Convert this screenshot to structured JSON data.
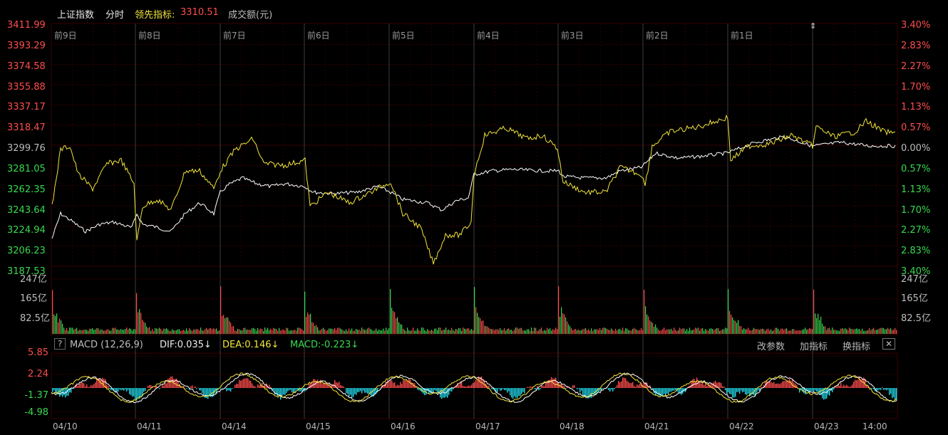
{
  "header": {
    "index_name": "上证指数",
    "mode": "分时",
    "leading_label": "领先指标:",
    "leading_value": "3310.51",
    "volume_label": "成交额(元)"
  },
  "price_axis": {
    "left_labels": [
      "3411.99",
      "3393.29",
      "3374.58",
      "3355.88",
      "3337.17",
      "3318.47",
      "3299.76",
      "3281.05",
      "3262.35",
      "3243.64",
      "3224.94",
      "3206.23",
      "3187.53"
    ],
    "right_labels": [
      "3.40%",
      "2.83%",
      "2.27%",
      "1.70%",
      "1.13%",
      "0.57%",
      "0.00%",
      "0.57%",
      "1.13%",
      "1.70%",
      "2.27%",
      "2.83%",
      "3.40%"
    ]
  },
  "day_labels": [
    "前9日",
    "前8日",
    "前7日",
    "前6日",
    "前5日",
    "前4日",
    "前3日",
    "前2日",
    "前1日"
  ],
  "volume_axis": {
    "labels": [
      "247亿",
      "165亿",
      "82.5亿"
    ]
  },
  "macd": {
    "help": "?",
    "name": "MACD (12,26,9)",
    "dif": "DIF:0.035↓",
    "dea": "DEA:0.146↓",
    "macd": "MACD:-0.223↓",
    "btn_params": "改参数",
    "btn_add": "加指标",
    "btn_switch": "换指标",
    "btn_close": "✕",
    "axis_labels": [
      "5.85",
      "2.24",
      "-1.37",
      "-4.98"
    ]
  },
  "date_labels": [
    "04/10",
    "04/11",
    "04/14",
    "04/15",
    "04/16",
    "04/17",
    "04/18",
    "04/21",
    "04/22",
    "04/23",
    "14:00"
  ],
  "colors": {
    "up": "#ff4d4d",
    "down": "#38d94f",
    "price_line": "#ffffff",
    "leading_line": "#f2e53a",
    "macd_neg": "#22d8e8",
    "grid": "#3a0000"
  }
}
